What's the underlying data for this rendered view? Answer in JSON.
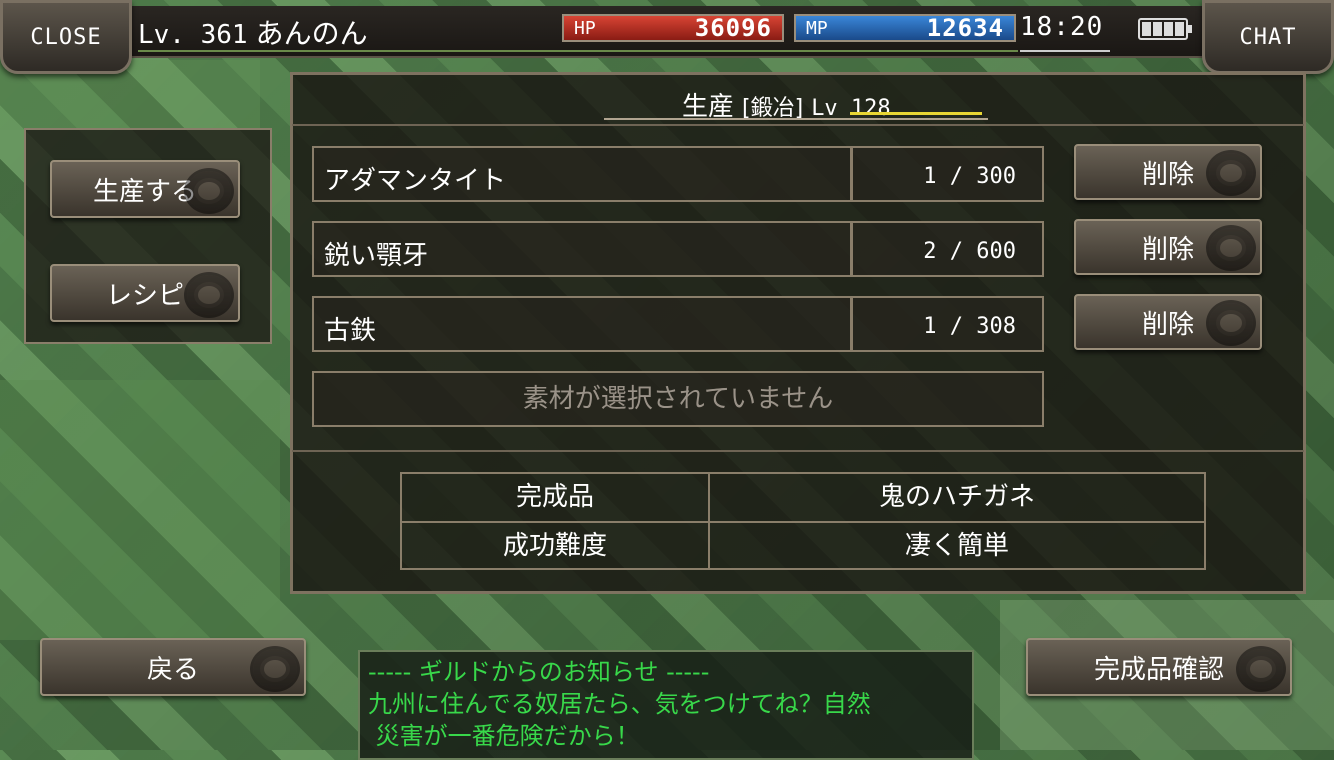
{
  "topbar": {
    "close_label": "CLOSE",
    "chat_label": "CHAT",
    "level": "Lv. 361",
    "player_name": "あんのん",
    "hp_label": "HP",
    "hp_value": "36096",
    "mp_label": "MP",
    "mp_value": "12634",
    "time": "18:20"
  },
  "sidebar": {
    "produce_label": "生産する",
    "recipe_label": "レシピ"
  },
  "panel": {
    "title": "生産",
    "job": "[鍛冶]",
    "level": "Lv  128"
  },
  "materials": [
    {
      "name": "アダマンタイト",
      "qty": "1 /  300",
      "delete_label": "削除"
    },
    {
      "name": "鋭い顎牙",
      "qty": "2 /  600",
      "delete_label": "削除"
    },
    {
      "name": "古鉄",
      "qty": "1 /  308",
      "delete_label": "削除"
    }
  ],
  "empty_slot": "素材が選択されていません",
  "result": {
    "product_label": "完成品",
    "product_value": "鬼のハチガネ",
    "difficulty_label": "成功難度",
    "difficulty_value": "凄く簡単"
  },
  "bottom": {
    "back_label": "戻る",
    "confirm_label": "完成品確認"
  },
  "notice": {
    "header": "----- ギルドからのお知らせ -----",
    "line1": "九州に住んでる奴居たら、気をつけてね？自然",
    "line2": " 災害が一番危険だから！"
  },
  "colors": {
    "hp_bar": "#c8342a",
    "mp_bar": "#2a6ac0",
    "notice_text": "#38d84a",
    "level_underline": "#e8d634"
  }
}
